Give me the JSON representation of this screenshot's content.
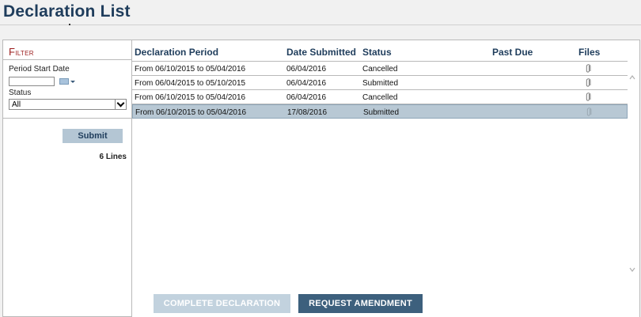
{
  "page": {
    "title": "Declaration List"
  },
  "filter": {
    "heading_first": "F",
    "heading_rest": "ilter",
    "period_start_label": "Period Start Date",
    "period_start_value": "",
    "status_label": "Status",
    "status_selected": "All",
    "submit_label": "Submit",
    "lines_count": "6 Lines"
  },
  "table": {
    "columns": [
      "Declaration Period",
      "Date Submitted",
      "Status",
      "Past Due",
      "Files"
    ],
    "rows": [
      {
        "period": "From 06/10/2015 to 05/04/2016",
        "date_submitted": "06/04/2016",
        "status": "Cancelled",
        "past_due": "",
        "files": "paperclip-icon"
      },
      {
        "period": "From 06/04/2015 to 05/10/2015",
        "date_submitted": "06/04/2016",
        "status": "Submitted",
        "past_due": "",
        "files": "paperclip-icon"
      },
      {
        "period": "From 06/10/2015 to 05/04/2016",
        "date_submitted": "06/04/2016",
        "status": "Cancelled",
        "past_due": "",
        "files": "paperclip-icon"
      },
      {
        "period": "From 06/10/2015 to 05/04/2016",
        "date_submitted": "17/08/2016",
        "status": "Submitted",
        "past_due": "",
        "files": "paperclip-icon"
      }
    ],
    "selected_row": 3
  },
  "actions": {
    "complete_label": "COMPLETE DECLARATION",
    "amend_label": "REQUEST AMENDMENT"
  },
  "colors": {
    "title": "#1f3d5c",
    "filter_heading": "#9b1c1c",
    "selected_row": "#b8c8d4",
    "primary_button": "#3d607d",
    "disabled_button": "#c2d2de"
  }
}
